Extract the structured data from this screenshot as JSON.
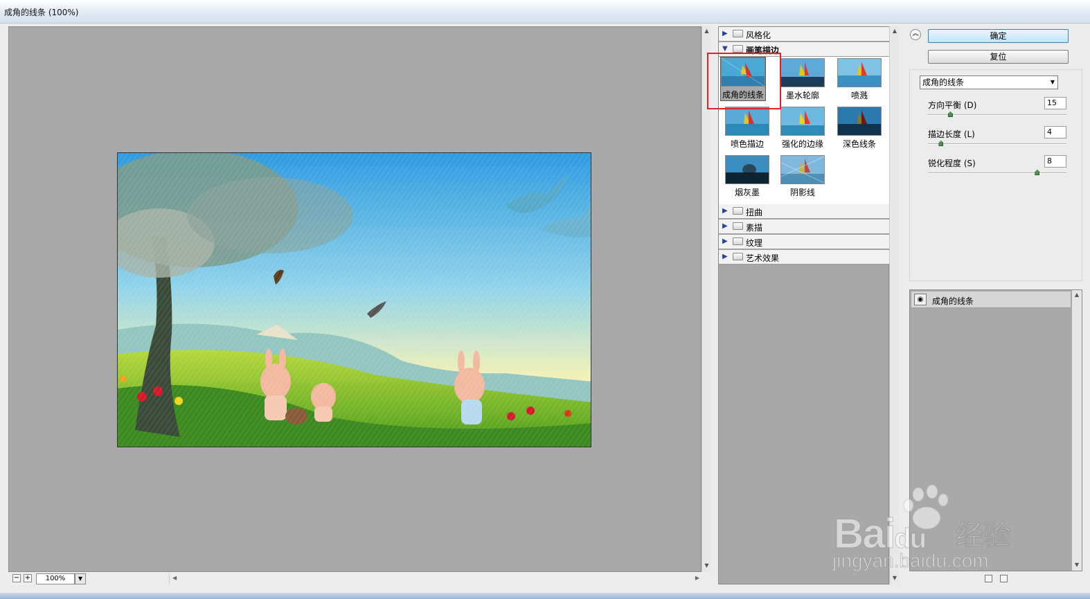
{
  "window": {
    "title": "成角的线条 (100%)"
  },
  "preview": {
    "zoom": "100%",
    "zoom_out": "−",
    "zoom_in": "+"
  },
  "gallery": {
    "categories": [
      {
        "label": "风格化",
        "expanded": false
      },
      {
        "label": "画笔描边",
        "expanded": true
      },
      {
        "label": "扭曲",
        "expanded": false
      },
      {
        "label": "素描",
        "expanded": false
      },
      {
        "label": "纹理",
        "expanded": false
      },
      {
        "label": "艺术效果",
        "expanded": false
      }
    ],
    "thumbnails": [
      {
        "label": "成角的线条",
        "selected": true
      },
      {
        "label": "墨水轮廓",
        "selected": false
      },
      {
        "label": "喷溅",
        "selected": false
      },
      {
        "label": "喷色描边",
        "selected": false
      },
      {
        "label": "强化的边缘",
        "selected": false
      },
      {
        "label": "深色线条",
        "selected": false
      },
      {
        "label": "烟灰墨",
        "selected": false
      },
      {
        "label": "阴影线",
        "selected": false
      }
    ]
  },
  "actions": {
    "ok_label": "确定",
    "reset_label": "复位"
  },
  "settings": {
    "filter_select": "成角的线条",
    "params": [
      {
        "label": "方向平衡 (D)",
        "value": "15",
        "max": 100
      },
      {
        "label": "描边长度 (L)",
        "value": "4",
        "max": 50
      },
      {
        "label": "锐化程度 (S)",
        "value": "8",
        "max": 10
      }
    ]
  },
  "layers": {
    "items": [
      {
        "label": "成角的线条"
      }
    ]
  },
  "watermark": {
    "brand": "Bai",
    "brand2": "du",
    "cn": "经验",
    "url": "jingyan.baidu.com"
  },
  "colors": {
    "highlight": "#e0202a",
    "primary_button": "#bee6fd"
  }
}
